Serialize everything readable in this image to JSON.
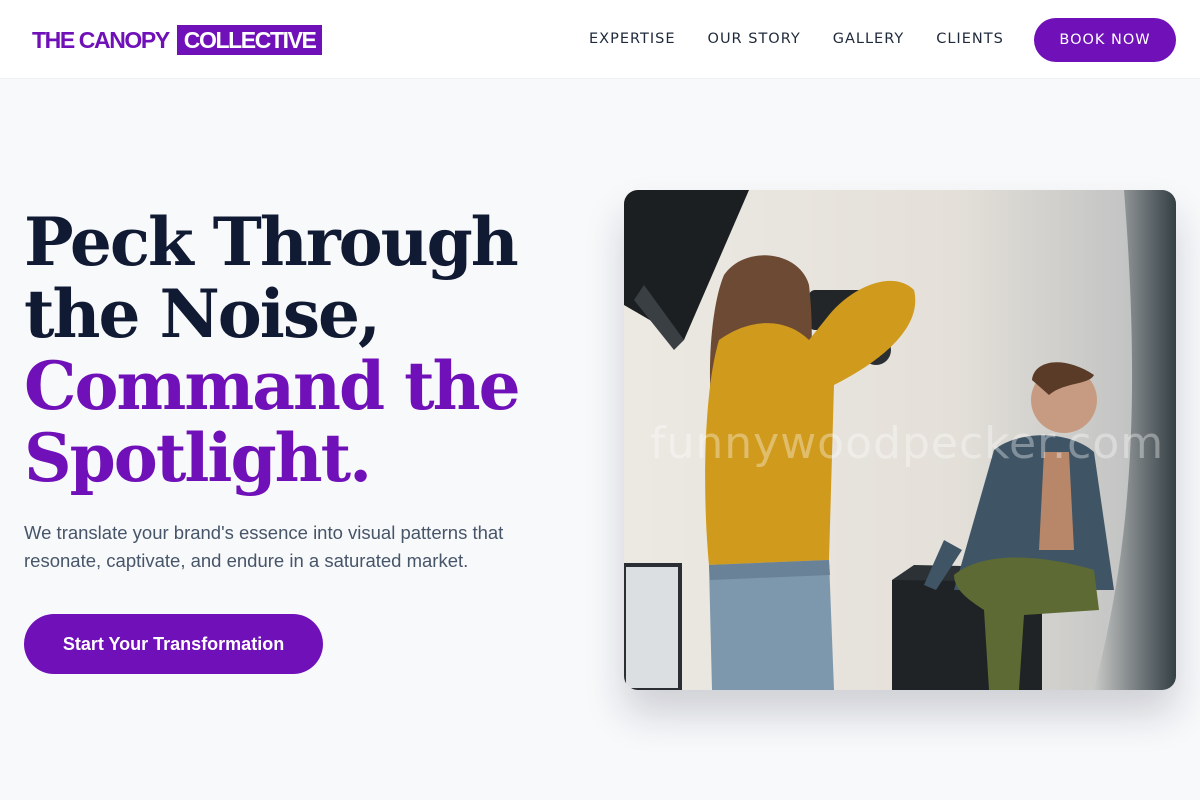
{
  "brand": {
    "logo_part1": "THE CANOPY",
    "logo_part2": "COLLECTIVE"
  },
  "nav": {
    "items": [
      {
        "label": "EXPERTISE"
      },
      {
        "label": "OUR STORY"
      },
      {
        "label": "GALLERY"
      },
      {
        "label": "CLIENTS"
      }
    ],
    "cta_label": "BOOK NOW"
  },
  "hero": {
    "headline_line1": "Peck Through",
    "headline_line2": "the Noise,",
    "headline_line3": "Command the",
    "headline_line4": "Spotlight.",
    "subtext": "We translate your brand's essence into visual patterns that resonate, captivate, and endure in a saturated market.",
    "cta_label": "Start Your Transformation"
  },
  "photo": {
    "watermark": "funnywoodpecker.com"
  },
  "colors": {
    "accent": "#7010b8",
    "heading": "#111a33",
    "body_text": "#475569",
    "background": "#f8f9fb"
  }
}
